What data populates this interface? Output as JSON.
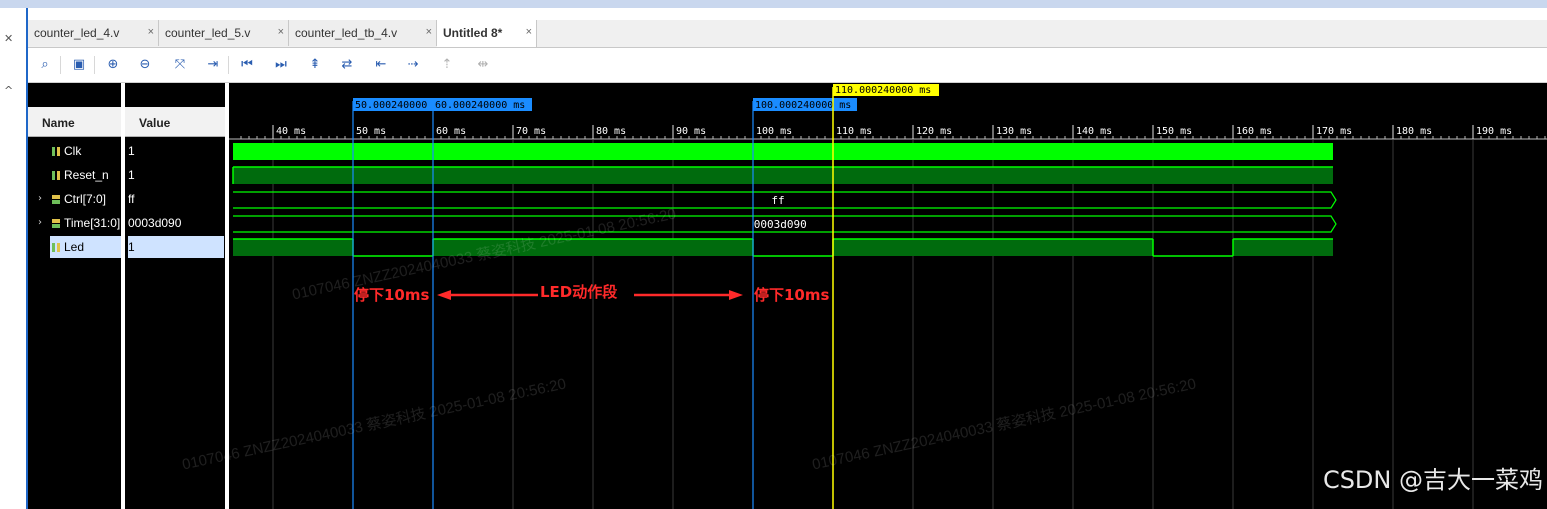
{
  "tabs": [
    {
      "label": "counter_led_4.v",
      "close": "×"
    },
    {
      "label": "counter_led_5.v",
      "close": "×"
    },
    {
      "label": "counter_led_tb_4.v",
      "close": "×"
    },
    {
      "label": "Untitled 8*",
      "close": "×"
    }
  ],
  "toolbar": {
    "buttons": [
      "search-icon",
      "save-icon",
      "zoom-in-icon",
      "zoom-out-icon",
      "zoom-fit-icon",
      "goto-cursor-icon",
      "go-first-icon",
      "go-last-icon",
      "add-marker-icon",
      "swap-cursor-icon",
      "prev-transition-icon",
      "next-transition-icon",
      "prev-edge-icon",
      "next-edge-icon"
    ]
  },
  "columns": {
    "name": "Name",
    "value": "Value"
  },
  "signals": [
    {
      "name": "Clk",
      "value": "1",
      "expandable": false,
      "icon": "bit-icon"
    },
    {
      "name": "Reset_n",
      "value": "1",
      "expandable": false,
      "icon": "bit-icon"
    },
    {
      "name": "Ctrl[7:0]",
      "value": "ff",
      "expandable": true,
      "icon": "bus-icon"
    },
    {
      "name": "Time[31:0]",
      "value": "0003d090",
      "expandable": true,
      "icon": "bus-icon"
    },
    {
      "name": "Led",
      "value": "1",
      "expandable": false,
      "icon": "bit-icon",
      "selected": true
    }
  ],
  "markers": [
    {
      "label": "50.000240000",
      "t": 50,
      "color": "#1a8cff"
    },
    {
      "label": "60.000240000 ms",
      "t": 60,
      "color": "#1a8cff"
    },
    {
      "label": "100.000240000 ms",
      "t": 100,
      "color": "#1a8cff"
    }
  ],
  "cursor": {
    "label": "110.000240000 ms",
    "t": 110,
    "color": "#ffff00"
  },
  "ruler": {
    "start": 35,
    "end": 200,
    "major_step": 10,
    "unit": "ms",
    "ticks": [
      "40 ms",
      "50 ms",
      "60 ms",
      "70 ms",
      "80 ms",
      "90 ms",
      "100 ms",
      "110 ms",
      "120 ms",
      "130 ms",
      "140 ms",
      "150 ms",
      "160 ms",
      "170 ms",
      "180 ms",
      "190 ms"
    ]
  },
  "bus_labels": {
    "ctrl": "ff",
    "time": "0003d090"
  },
  "annotations": {
    "left": "停下10ms",
    "middle": "LED动作段",
    "right": "停下10ms"
  },
  "watermark": {
    "text": "0107046  ZNZZ2024040033  蔡姿科技  2025-01-08 20:56:20",
    "csdn": "CSDN @吉大一菜鸡"
  },
  "colors": {
    "wave": "#00ff00",
    "wave_dim": "#006b0d",
    "marker": "#1a8cff",
    "cursor": "#ffff00",
    "annotation": "#ff2a2a",
    "bg": "#000000"
  }
}
